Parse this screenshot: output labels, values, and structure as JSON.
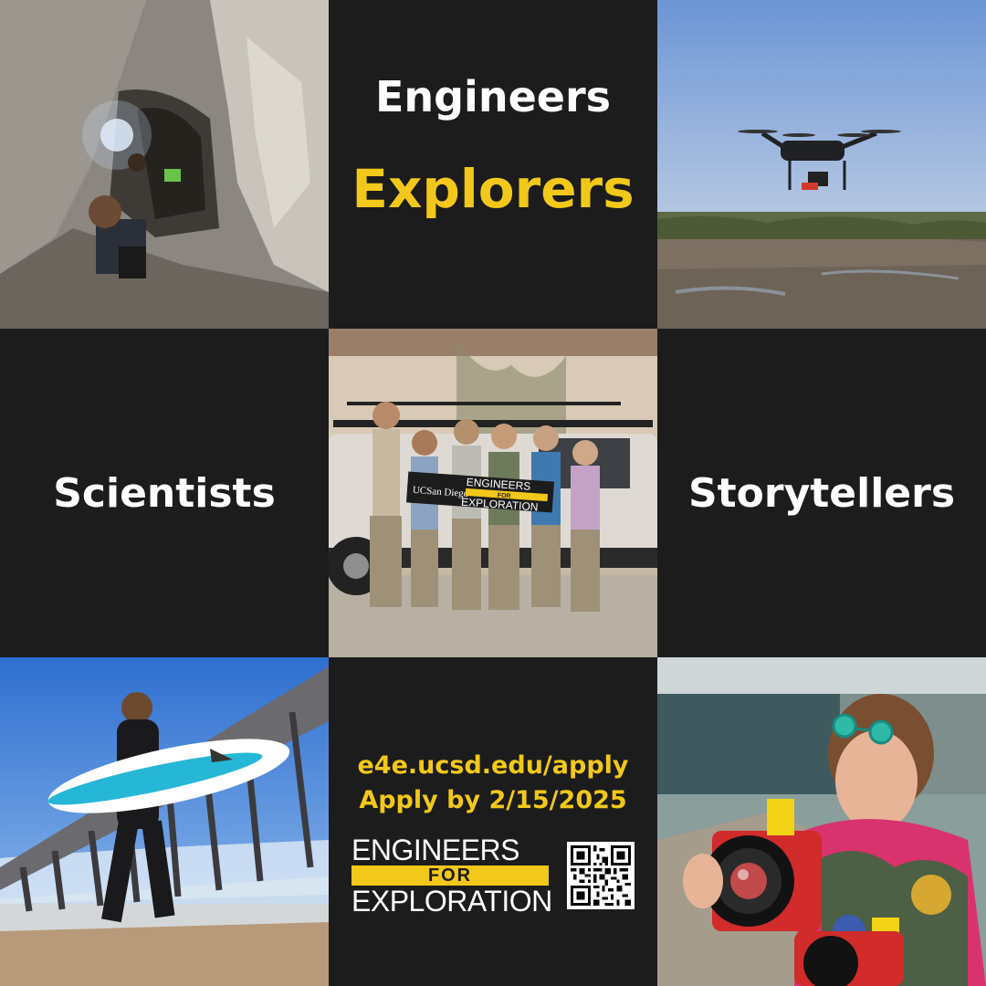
{
  "words": {
    "engineers": "Engineers",
    "explorers": "Explorers",
    "scientists": "Scientists",
    "storytellers": "Storytellers"
  },
  "apply": {
    "url": "e4e.ucsd.edu/apply",
    "deadline": "Apply by 2/15/2025"
  },
  "logo": {
    "line1": "ENGINEERS",
    "line2": "FOR",
    "line3": "EXPLORATION"
  },
  "group_photo": {
    "banner_left": "UCSan Diego",
    "banner_line1": "ENGINEERS",
    "banner_line2": "FOR",
    "banner_line3": "EXPLORATION"
  },
  "colors": {
    "background": "#1c1c1c",
    "accent": "#f2c81a",
    "text": "#ffffff"
  },
  "icons": [
    "qr-code-icon"
  ]
}
